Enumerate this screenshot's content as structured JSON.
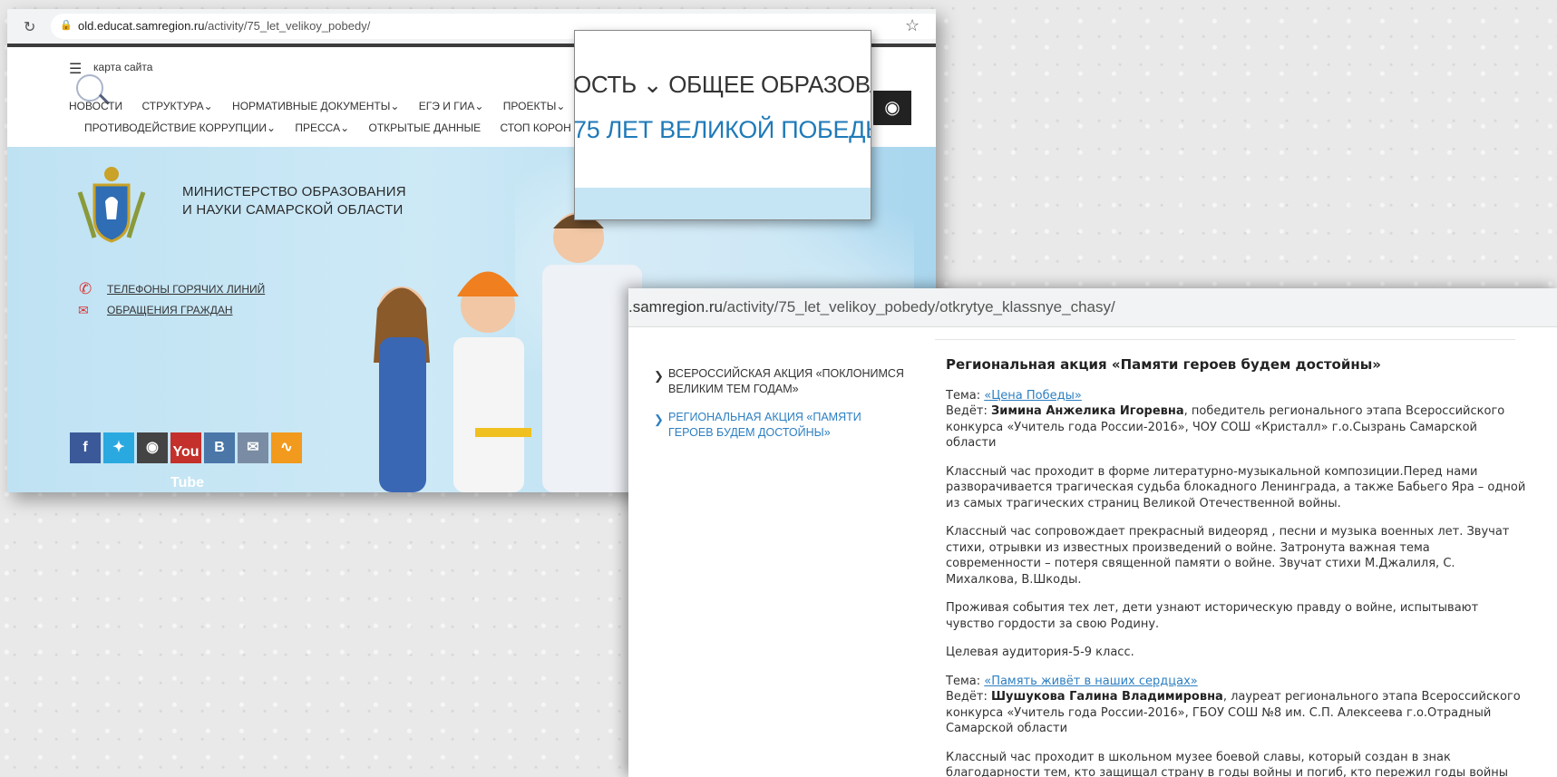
{
  "screenshot1": {
    "url_domain": "old.educat.samregion.ru",
    "url_path": "/activity/75_let_velikoy_pobedy/",
    "sitemap_label": "карта сайта",
    "nav_row1": [
      "НОВОСТИ",
      "СТРУКТУРА",
      "НОРМАТИВНЫЕ ДОКУМЕНТЫ",
      "ЕГЭ И ГИА",
      "ПРОЕКТЫ"
    ],
    "nav_row2": [
      "ПРОТИВОДЕЙСТВИЕ КОРРУПЦИИ",
      "ПРЕССА",
      "ОТКРЫТЫЕ ДАННЫЕ",
      "СТОП КОРОН"
    ],
    "ministry_line1": "МИНИСТЕРСТВО ОБРАЗОВАНИЯ",
    "ministry_line2": "И НАУКИ САМАРСКОЙ ОБЛАСТИ",
    "hotline_link": "ТЕЛЕФОНЫ ГОРЯЧИХ ЛИНИЙ",
    "appeal_link": "ОБРАЩЕНИЯ ГРАЖДАН",
    "social": {
      "fb": "f",
      "vk": "B",
      "yt_top": "You",
      "yt_bottom": "Tube"
    },
    "zoom_line1": "ОСТЬ ⌄  ОБЩЕЕ ОБРАЗОВА",
    "zoom_line2": "75 ЛЕТ ВЕЛИКОЙ ПОБЕДЫ"
  },
  "screenshot2": {
    "url_domain": ".samregion.ru",
    "url_path": "/activity/75_let_velikoy_pobedy/otkrytye_klassnye_chasy/",
    "sidebar": [
      {
        "label": "ВСЕРОССИЙСКАЯ АКЦИЯ «ПОКЛОНИМСЯ ВЕЛИКИМ ТЕМ ГОДАМ»",
        "active": false
      },
      {
        "label": "РЕГИОНАЛЬНАЯ АКЦИЯ «ПАМЯТИ ГЕРОЕВ БУДЕМ ДОСТОЙНЫ»",
        "active": true
      }
    ],
    "heading": "Региональная акция «Памяти героев будем достойны»",
    "topic1_label": "Тема: ",
    "topic1_link": "«Цена Победы»",
    "lead1_label": "Ведёт: ",
    "lead1_name": "Зимина Анжелика Игоревна",
    "lead1_rest": ", победитель регионального этапа Всероссийского конкурса «Учитель года России-2016», ЧОУ СОШ «Кристалл» г.о.Сызрань Самарской области",
    "p1": "Классный час проходит в форме литературно-музыкальной композиции.Перед нами разворачивается трагическая судьба блокадного Ленинграда, а также Бабьего Яра – одной из самых трагических страниц Великой Отечественной войны.",
    "p2": "Классный час сопровождает прекрасный видеоряд , песни и музыка военных лет.  Звучат стихи, отрывки из известных произведений о войне. Затронута важная тема современности – потеря священной памяти о войне. Звучат стихи М.Джалиля, С. Михалкова, В.Шкоды.",
    "p3": "Проживая события тех лет, дети узнают историческую правду о войне,  испытывают чувство гордости за свою Родину.",
    "p4": "Целевая аудитория-5-9 класс.",
    "topic2_label": "Тема: ",
    "topic2_link": "«Память живёт в наших сердцах»",
    "lead2_label": "Ведёт: ",
    "lead2_name": "Шушукова Галина Владимировна",
    "lead2_rest": ", лауреат регионального этапа Всероссийского конкурса «Учитель года России-2016», ГБОУ СОШ №8 им. С.П. Алексеева г.о.Отрадный Самарской области",
    "p5": "Классный час проходит в школьном музее боевой славы, который создан в знак благодарности тем, кто защищал страну в годы войны и погиб, кто пережил годы войны"
  }
}
